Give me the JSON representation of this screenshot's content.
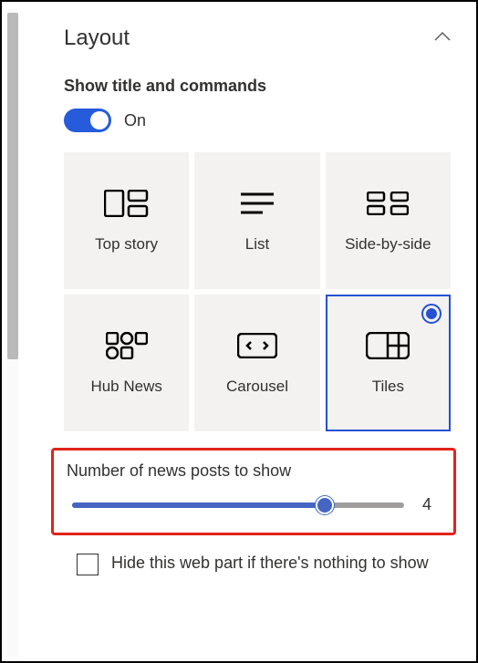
{
  "section_title": "Layout",
  "toggle_section": {
    "label": "Show title and commands",
    "state_text": "On"
  },
  "layout_options": {
    "top_story": "Top story",
    "list": "List",
    "side_by_side": "Side-by-side",
    "hub_news": "Hub News",
    "carousel": "Carousel",
    "tiles": "Tiles"
  },
  "slider": {
    "label": "Number of news posts to show",
    "value": "4"
  },
  "checkbox": {
    "label": "Hide this web part if there's nothing to show"
  }
}
